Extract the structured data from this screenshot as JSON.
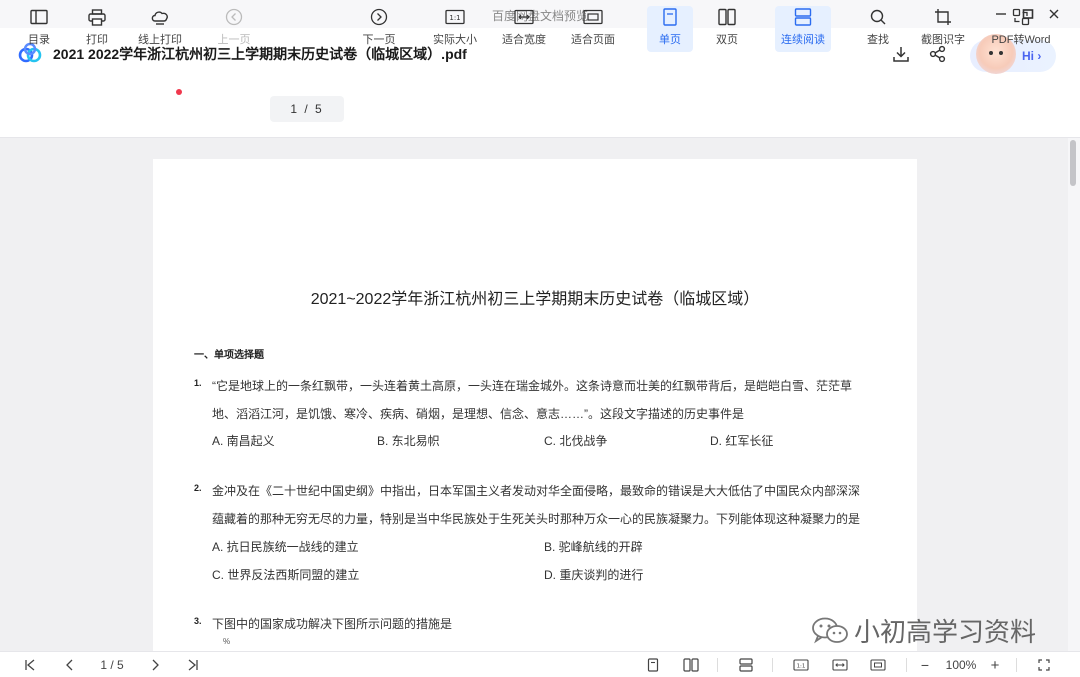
{
  "window": {
    "title": "百度网盘文档预览"
  },
  "file": {
    "name": "2021 2022学年浙江杭州初三上学期期末历史试卷（临城区域）.pdf",
    "hi_label": "Hi ›"
  },
  "toolbar": {
    "catalog": "目录",
    "print": "打印",
    "online_print": "线上打印",
    "prev": "上一页",
    "page_indicator": "1 / 5",
    "next": "下一页",
    "actual_size": "实际大小",
    "fit_width": "适合宽度",
    "fit_page": "适合页面",
    "single": "单页",
    "double": "双页",
    "continuous": "连续阅读",
    "find": "查找",
    "ocr": "截图识字",
    "pdf_word": "PDF转Word"
  },
  "document": {
    "title": "2021~2022学年浙江杭州初三上学期期末历史试卷（临城区域）",
    "section": "一、单项选择题",
    "q1": {
      "num": "1.",
      "line1": "“它是地球上的一条红飘带，一头连着黄土高原，一头连在瑞金城外。这条诗意而壮美的红飘带背后，是皑皑白雪、茫茫草",
      "line2": "地、滔滔江河，是饥饿、寒冷、疾病、硝烟，是理想、信念、意志……”。这段文字描述的历史事件是",
      "opt_a": "A. 南昌起义",
      "opt_b": "B. 东北易帜",
      "opt_c": "C. 北伐战争",
      "opt_d": "D. 红军长征"
    },
    "q2": {
      "num": "2.",
      "line1": "金冲及在《二十世纪中国史纲》中指出，日本军国主义者发动对华全面侵略，最致命的错误是大大低估了中国民众内部深深",
      "line2": "蕴藏着的那种无穷无尽的力量，特别是当中华民族处于生死关头时那种万众一心的民族凝聚力。下列能体现这种凝聚力的是",
      "opt_a": "A. 抗日民族统一战线的建立",
      "opt_b": "B. 驼峰航线的开辟",
      "opt_c": "C. 世界反法西斯同盟的建立",
      "opt_d": "D. 重庆谈判的进行"
    },
    "q3": {
      "num": "3.",
      "line1": "下图中的国家成功解决下图所示问题的措施是",
      "pct": "%"
    },
    "watermark": "小初高学习资料"
  },
  "bottombar": {
    "page_indicator": "1 / 5",
    "zoom": "100%",
    "minus": "−",
    "plus": "+"
  },
  "colors": {
    "accent": "#2b6cf0",
    "active_bg": "#e6f0ff",
    "notify": "#f0384d"
  }
}
